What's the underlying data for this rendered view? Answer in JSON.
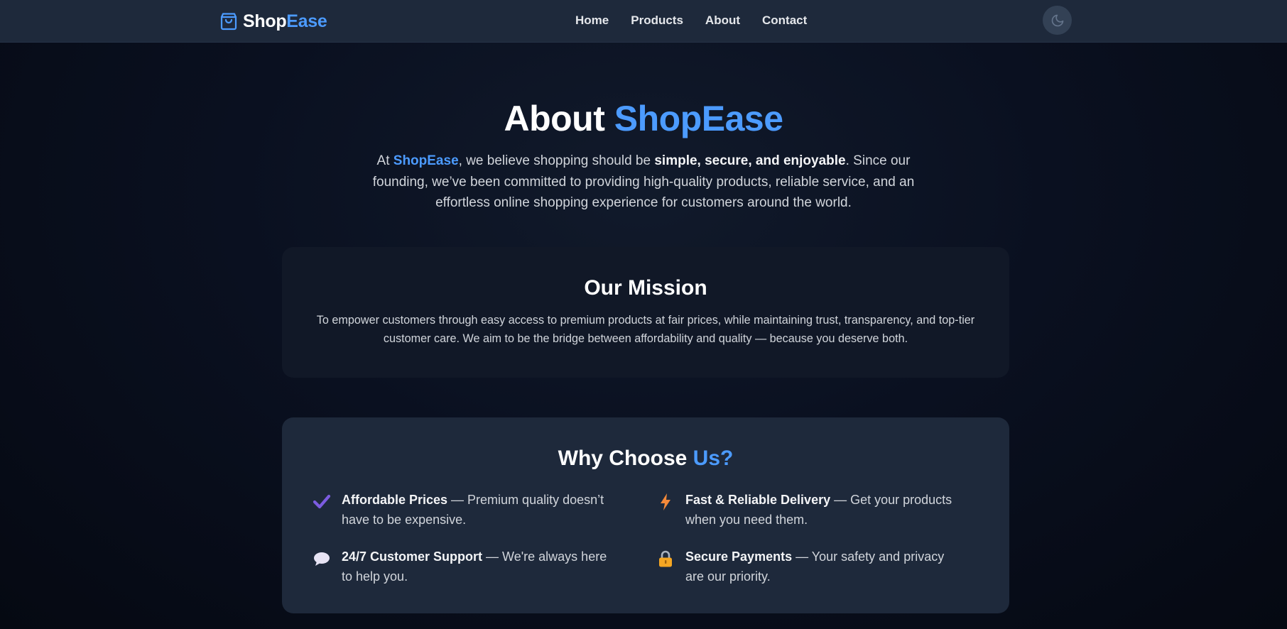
{
  "navbar": {
    "brand": {
      "part1": "Shop",
      "part2": "Ease",
      "icon": "shopping-bag-icon"
    },
    "links": [
      "Home",
      "Products",
      "About",
      "Contact"
    ],
    "theme_toggle_icon": "moon-icon"
  },
  "hero": {
    "title_main": "About ",
    "title_accent": "ShopEase",
    "text_1": "At ",
    "text_brand": "ShopEase",
    "text_2": ", we believe shopping should be ",
    "text_bold": "simple, secure, and enjoyable",
    "text_3": ". Since our founding, we’ve been committed to providing high-quality products, reliable service, and an effortless online shopping experience for customers around the world."
  },
  "mission": {
    "title": "Our Mission",
    "text": "To empower customers through easy access to premium products at fair prices, while maintaining trust, transparency, and top-tier customer care. We aim to be the bridge between affordability and quality — because you deserve both."
  },
  "why": {
    "title_main": "Why Choose ",
    "title_accent": "Us?",
    "features": [
      {
        "icon": "check-icon",
        "title": "Affordable Prices",
        "text": " — Premium quality doesn’t have to be expensive."
      },
      {
        "icon": "lightning-icon",
        "title": "Fast & Reliable Delivery",
        "text": " — Get your products when you need them."
      },
      {
        "icon": "speech-bubble-icon",
        "title": "24/7 Customer Support",
        "text": " — We're always here to help you."
      },
      {
        "icon": "lock-icon",
        "title": "Secure Payments",
        "text": " — Your safety and privacy are our priority."
      }
    ]
  },
  "colors": {
    "accent": "#4c9bff",
    "nav_bg": "#1e293b",
    "page_bg": "#0a1020",
    "card_dark": "#111827",
    "card_light": "#1e293b"
  }
}
